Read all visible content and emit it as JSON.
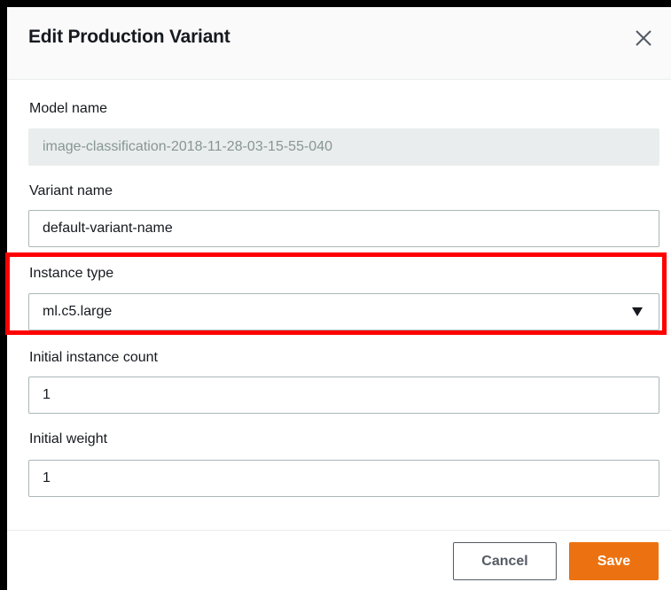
{
  "dialog": {
    "title": "Edit Production Variant",
    "close_icon": "close-icon"
  },
  "fields": {
    "model_name": {
      "label": "Model name",
      "value": "image-classification-2018-11-28-03-15-55-040",
      "disabled": true
    },
    "variant_name": {
      "label": "Variant name",
      "value": "default-variant-name"
    },
    "instance_type": {
      "label": "Instance type",
      "value": "ml.c5.large",
      "icon": "caret-down-icon"
    },
    "initial_instance_count": {
      "label": "Initial instance count",
      "value": "1"
    },
    "initial_weight": {
      "label": "Initial weight",
      "value": "1"
    }
  },
  "footer": {
    "cancel_label": "Cancel",
    "save_label": "Save"
  },
  "colors": {
    "accent": "#ec7211",
    "highlight": "#ff0000",
    "disabled_bg": "#eaeded"
  }
}
